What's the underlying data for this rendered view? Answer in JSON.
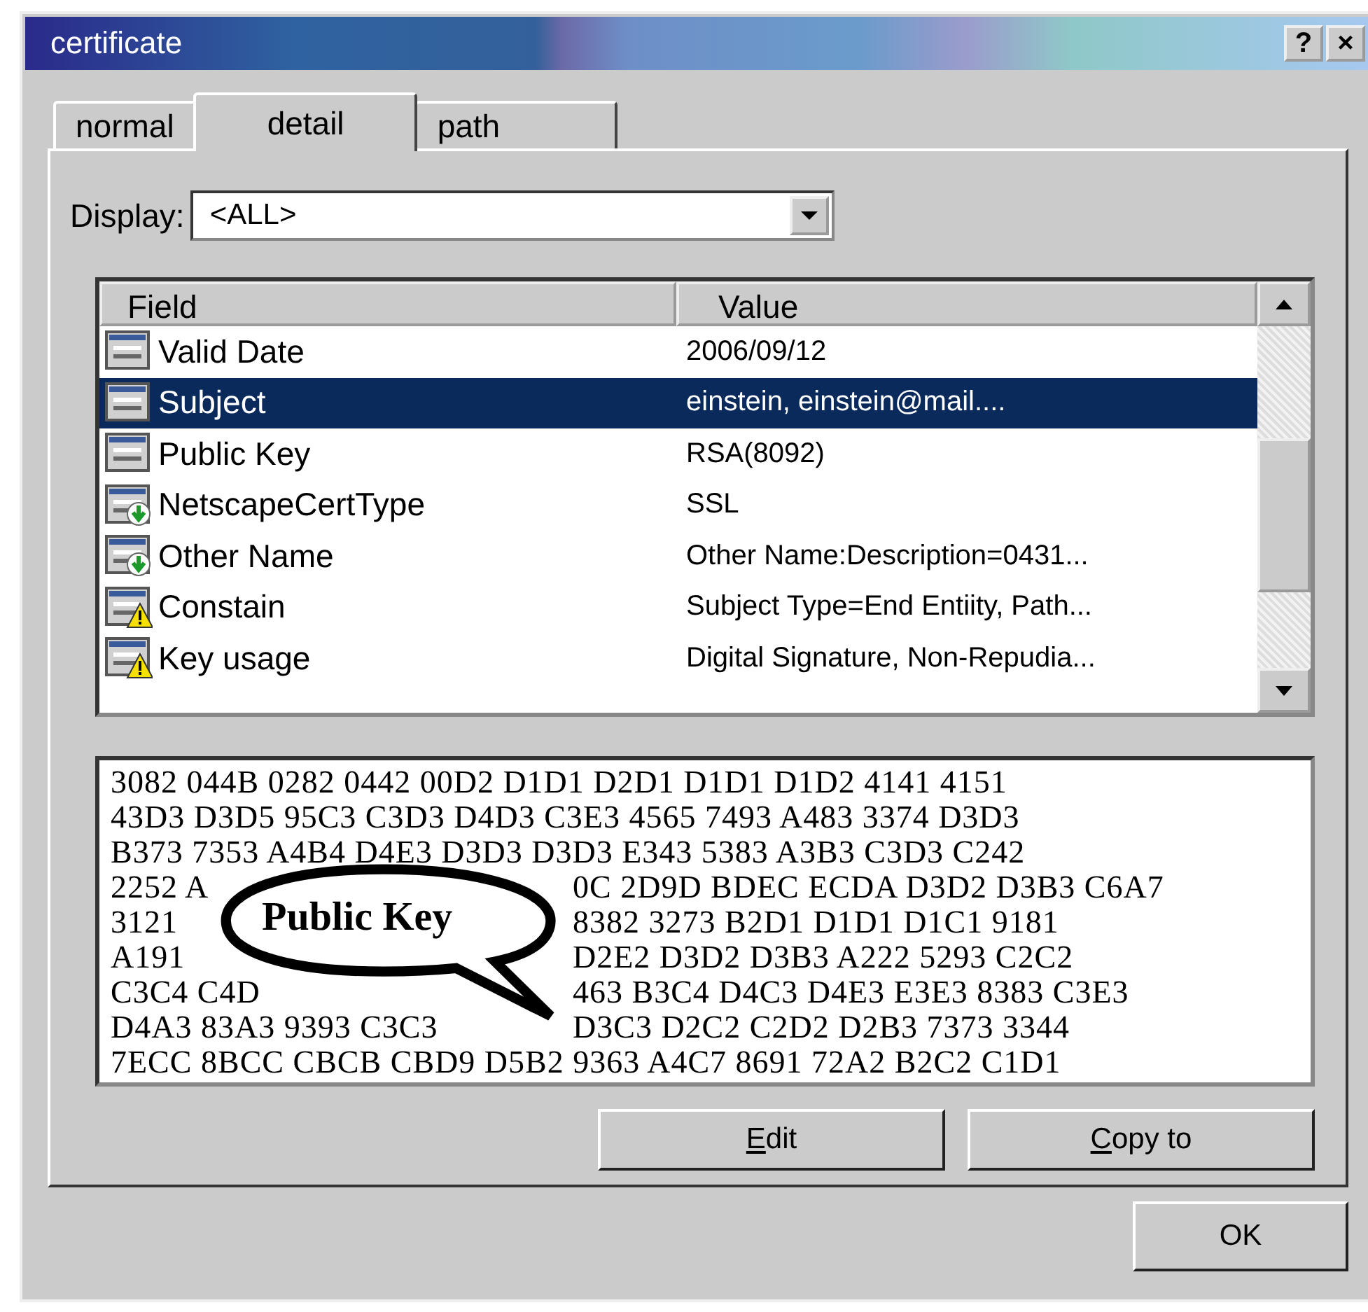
{
  "window": {
    "title": "certificate",
    "title_buttons": [
      "?",
      "×"
    ]
  },
  "tabs": [
    {
      "label": "normal",
      "selected": false
    },
    {
      "label": "detail",
      "selected": true
    },
    {
      "label": "path",
      "selected": false
    }
  ],
  "display": {
    "label": "Display:",
    "value": "<ALL>"
  },
  "table": {
    "columns": [
      "Field",
      "Value"
    ],
    "rows": [
      {
        "kind": "plain",
        "field": "Valid Date",
        "value": "2006/09/12",
        "selected": false
      },
      {
        "kind": "plain",
        "field": "Subject",
        "value": "einstein, einstein@mail....",
        "selected": true
      },
      {
        "kind": "plain",
        "field": "Public Key",
        "value": "RSA(8092)",
        "selected": false
      },
      {
        "kind": "download",
        "field": "NetscapeCertType",
        "value": "SSL",
        "selected": false
      },
      {
        "kind": "download",
        "field": "Other Name",
        "value": "Other Name:Description=0431...",
        "selected": false
      },
      {
        "kind": "warning",
        "field": "Constain",
        "value": "Subject Type=End Entiity, Path...",
        "selected": false
      },
      {
        "kind": "warning",
        "field": "Key usage",
        "value": "Digital Signature, Non-Repudia...",
        "selected": false
      }
    ]
  },
  "hex_lines": [
    [
      "3082 044B 0282 0442 00D2 D1D1 D2D1 D1D1 D1D2 4141 4151"
    ],
    [
      "43D3 D3D5 95C3 C3D3 D4D3 C3E3 4565 7493 A483 3374 D3D3"
    ],
    [
      "B373 7353 A4B4 D4E3 D3D3 D3D3 E343 5383 A3B3 C3D3 C242"
    ],
    [
      "2252 A",
      "0C 2D9D BDEC ECDA D3D2 D3B3 C6A7"
    ],
    [
      "3121",
      "8382 3273 B2D1 D1D1 D1C1 9181"
    ],
    [
      "A191",
      "D2E2 D3D2 D3B3 A222 5293 C2C2"
    ],
    [
      "C3C4 C4D",
      "463 B3C4 D4C3 D4E3 E3E3 8383 C3E3"
    ],
    [
      "D4A3 83A3 9393 C3C3",
      "D3C3 D2C2 C2D2 D2B3 7373 3344"
    ],
    [
      "7ECC 8BCC CBCB CBD9 D5B2 9363 A4C7 8691 72A2 B2C2 C1D1"
    ]
  ],
  "callout": {
    "text": "Public Key"
  },
  "buttons": [
    "Edit",
    "Copy to"
  ],
  "ok_button": "OK"
}
